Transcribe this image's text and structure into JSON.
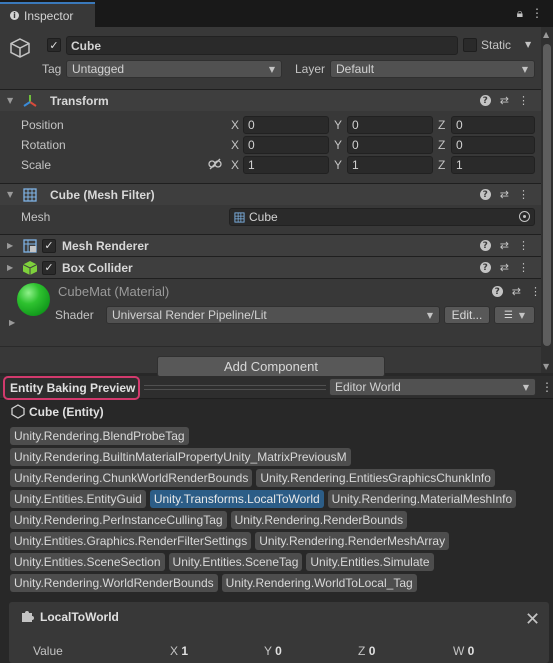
{
  "window": {
    "tab_title": "Inspector"
  },
  "object": {
    "name": "Cube",
    "active": true,
    "static_label": "Static",
    "static": false,
    "tag_label": "Tag",
    "tag_value": "Untagged",
    "layer_label": "Layer",
    "layer_value": "Default"
  },
  "transform": {
    "title": "Transform",
    "rows": [
      {
        "label": "Position",
        "x": "0",
        "y": "0",
        "z": "0"
      },
      {
        "label": "Rotation",
        "x": "0",
        "y": "0",
        "z": "0"
      },
      {
        "label": "Scale",
        "x": "1",
        "y": "1",
        "z": "1"
      }
    ],
    "axis": {
      "x": "X",
      "y": "Y",
      "z": "Z"
    }
  },
  "mesh_filter": {
    "title": "Cube (Mesh Filter)",
    "mesh_label": "Mesh",
    "mesh_value": "Cube"
  },
  "mesh_renderer": {
    "title": "Mesh Renderer",
    "enabled": true
  },
  "box_collider": {
    "title": "Box Collider",
    "enabled": true
  },
  "material": {
    "title": "CubeMat (Material)",
    "shader_label": "Shader",
    "shader_value": "Universal Render Pipeline/Lit",
    "edit_label": "Edit...",
    "preview_color": "#1fae2a"
  },
  "add_component_label": "Add Component",
  "baking": {
    "title": "Entity Baking Preview",
    "world": "Editor World",
    "entity_title": "Cube (Entity)",
    "tags": [
      [
        "Unity.Rendering.BlendProbeTag"
      ],
      [
        "Unity.Rendering.BuiltinMaterialPropertyUnity_MatrixPreviousM"
      ],
      [
        "Unity.Rendering.ChunkWorldRenderBounds",
        "Unity.Rendering.EntitiesGraphicsChunkInfo"
      ],
      [
        "Unity.Entities.EntityGuid",
        "Unity.Transforms.LocalToWorld",
        "Unity.Rendering.MaterialMeshInfo"
      ],
      [
        "Unity.Rendering.PerInstanceCullingTag",
        "Unity.Rendering.RenderBounds"
      ],
      [
        "Unity.Entities.Graphics.RenderFilterSettings",
        "Unity.Rendering.RenderMeshArray"
      ],
      [
        "Unity.Entities.SceneSection",
        "Unity.Entities.SceneTag",
        "Unity.Entities.Simulate"
      ],
      [
        "Unity.Rendering.WorldRenderBounds",
        "Unity.Rendering.WorldToLocal_Tag"
      ]
    ],
    "selected_tag": "Unity.Transforms.LocalToWorld",
    "highlight_color": "#d23a6d"
  },
  "local_to_world": {
    "title": "LocalToWorld",
    "value_label": "Value",
    "cols": [
      {
        "axis": "X",
        "value": "1"
      },
      {
        "axis": "Y",
        "value": "0"
      },
      {
        "axis": "Z",
        "value": "0"
      },
      {
        "axis": "W",
        "value": "0"
      }
    ]
  }
}
